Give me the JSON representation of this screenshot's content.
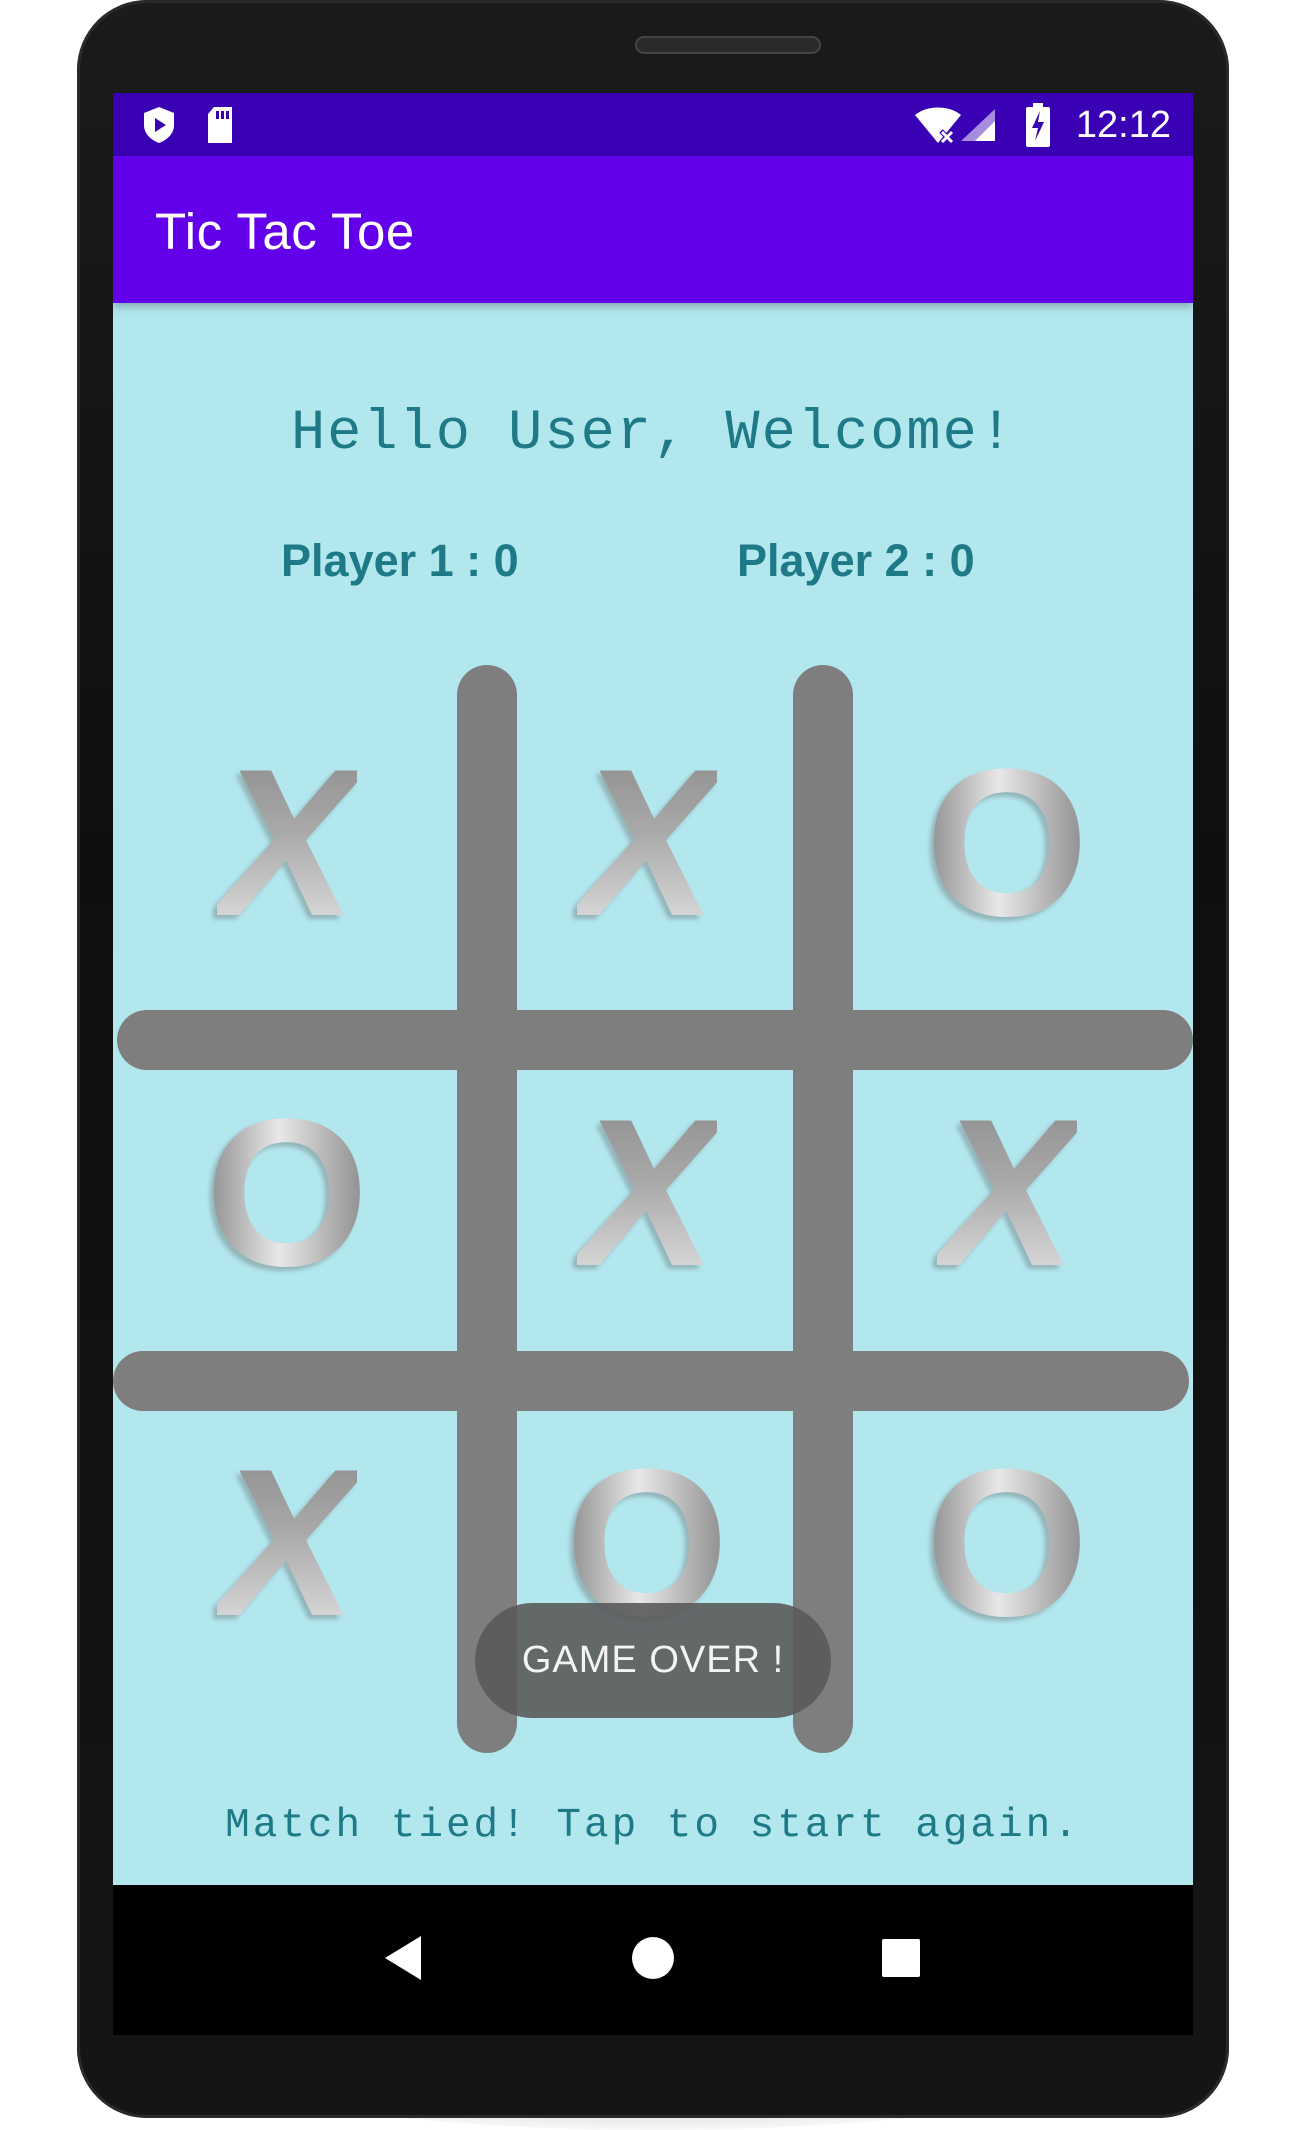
{
  "status_bar": {
    "time": "12:12",
    "icons": [
      "shield-icon",
      "sd-card-icon",
      "wifi-off-icon",
      "signal-icon",
      "battery-charging-icon"
    ]
  },
  "app_bar": {
    "title": "Tic Tac Toe"
  },
  "greeting": "Hello User, Welcome!",
  "scores": {
    "player1_label": "Player 1",
    "player1_score": "0",
    "player2_label": "Player 2",
    "player2_score": "0",
    "separator": " : "
  },
  "board": {
    "cells": [
      "X",
      "X",
      "O",
      "O",
      "X",
      "X",
      "X",
      "O",
      "O"
    ]
  },
  "toast": "GAME OVER !",
  "status_message": "Match tied! Tap to start again.",
  "nav_bar": {
    "back": "back-icon",
    "home": "home-icon",
    "recents": "recents-icon"
  },
  "colors": {
    "status_bar": "#3a00b4",
    "app_bar": "#6200ea",
    "background": "#b2e7ee",
    "text_teal": "#1f7a87",
    "grid": "#7e7e7e"
  }
}
